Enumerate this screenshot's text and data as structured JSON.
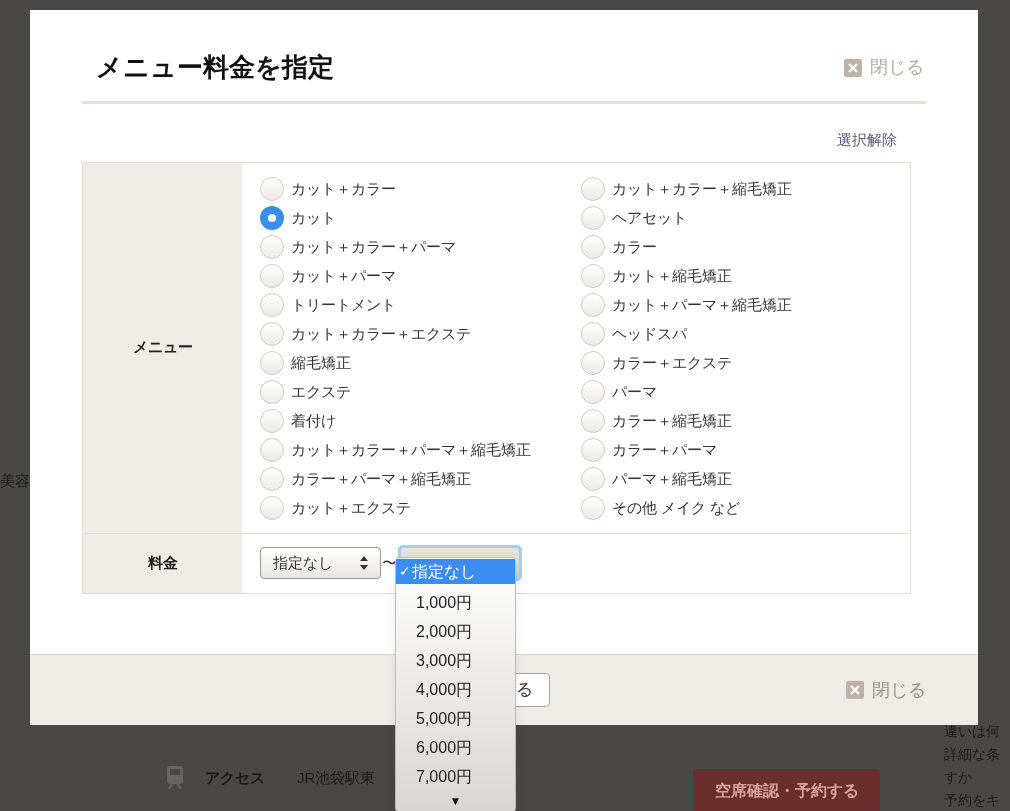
{
  "background": {
    "texts_left": [
      "美容"
    ],
    "texts_right": [
      "違いは何",
      "詳細な条",
      "すか",
      "予約をキ"
    ],
    "access_label": "アクセス",
    "access_text": "JR池袋駅東",
    "reserve_button": "空席確認・予約する"
  },
  "dialog": {
    "title": "メニュー料金を指定",
    "close_top": "閉じる",
    "clear_link": "選択解除",
    "menu_label": "メニュー",
    "menu_columns": [
      [
        {
          "label": "カット＋カラー",
          "selected": false
        },
        {
          "label": "カット",
          "selected": true
        },
        {
          "label": "カット＋カラー＋パーマ",
          "selected": false
        },
        {
          "label": "カット＋パーマ",
          "selected": false
        },
        {
          "label": "トリートメント",
          "selected": false
        },
        {
          "label": "カット＋カラー＋エクステ",
          "selected": false
        },
        {
          "label": "縮毛矯正",
          "selected": false
        },
        {
          "label": "エクステ",
          "selected": false
        },
        {
          "label": "着付け",
          "selected": false
        },
        {
          "label": "カット＋カラー＋パーマ＋縮毛矯正",
          "selected": false
        },
        {
          "label": "カラー＋パーマ＋縮毛矯正",
          "selected": false
        },
        {
          "label": "カット＋エクステ",
          "selected": false
        }
      ],
      [
        {
          "label": "カット＋カラー＋縮毛矯正",
          "selected": false
        },
        {
          "label": "ヘアセット",
          "selected": false
        },
        {
          "label": "カラー",
          "selected": false
        },
        {
          "label": "カット＋縮毛矯正",
          "selected": false
        },
        {
          "label": "カット＋パーマ＋縮毛矯正",
          "selected": false
        },
        {
          "label": "ヘッドスパ",
          "selected": false
        },
        {
          "label": "カラー＋エクステ",
          "selected": false
        },
        {
          "label": "パーマ",
          "selected": false
        },
        {
          "label": "カラー＋縮毛矯正",
          "selected": false
        },
        {
          "label": "カラー＋パーマ",
          "selected": false
        },
        {
          "label": "パーマ＋縮毛矯正",
          "selected": false
        },
        {
          "label": "その他 メイク など",
          "selected": false
        }
      ]
    ],
    "price_label": "料金",
    "price_from": "指定なし",
    "separator": "〜",
    "price_to_options": [
      {
        "label": "指定なし",
        "selected": true
      },
      {
        "label": "1,000円",
        "selected": false
      },
      {
        "label": "2,000円",
        "selected": false
      },
      {
        "label": "3,000円",
        "selected": false
      },
      {
        "label": "4,000円",
        "selected": false
      },
      {
        "label": "5,000円",
        "selected": false
      },
      {
        "label": "6,000円",
        "selected": false
      },
      {
        "label": "7,000円",
        "selected": false
      }
    ],
    "check_mark": "✓",
    "scroll_arrow": "▼",
    "footer_button": "る",
    "close_bottom": "閉じる"
  }
}
